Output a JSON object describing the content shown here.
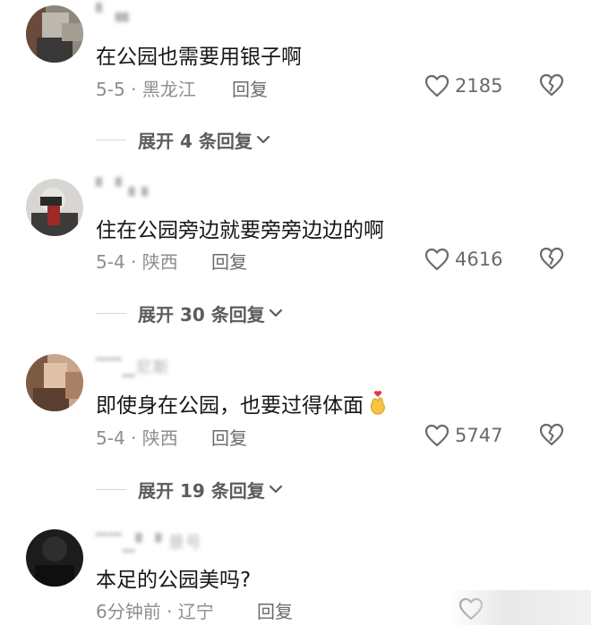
{
  "comments": [
    {
      "username": "▘▗▖",
      "text": "在公园也需要用银子啊",
      "meta": "5-5 · 黑龙江",
      "reply_label": "回复",
      "likes": "2185",
      "expand_label": "展开 4 条回复"
    },
    {
      "username": "▘▝▗ ▖",
      "text": "住在公园旁边就要旁旁边边的啊",
      "meta": "5-4 · 陕西",
      "reply_label": "回复",
      "likes": "4616",
      "expand_label": "展开 30 条回复"
    },
    {
      "username": "▔▔▁尼斯",
      "text": "即使身在公园，也要过得体面",
      "meta": "5-4 · 陕西",
      "reply_label": "回复",
      "likes": "5747",
      "expand_label": "展开 19 条回复"
    },
    {
      "username": "▔▔▁▘▝ 景号",
      "text": "本足的公园美吗?",
      "meta": "6分钟前 · 辽宁",
      "reply_label": "回复",
      "likes": "",
      "expand_label": ""
    }
  ],
  "colors": {
    "text": "#161616",
    "meta": "#8e8e8e",
    "icon": "#6a6a6a"
  }
}
